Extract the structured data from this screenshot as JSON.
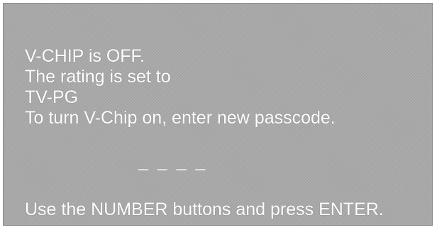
{
  "message": {
    "line1": "V-CHIP is OFF.",
    "line2": "The rating is set to",
    "line3": "TV-PG",
    "line4": "To turn V-Chip on, enter new passcode."
  },
  "passcode": {
    "value": "_ _ _ _"
  },
  "instruction": {
    "text": "Use the NUMBER buttons and press ENTER."
  },
  "colors": {
    "background": "#a9a9a9",
    "text": "#ffffff"
  }
}
